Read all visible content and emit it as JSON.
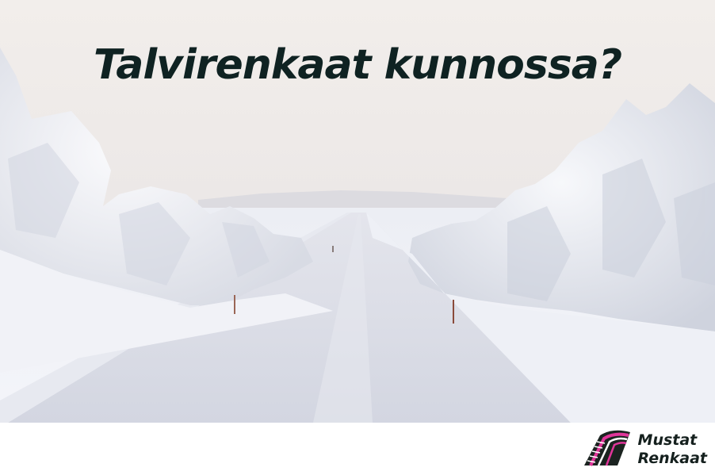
{
  "headline": "Talvirenkaat kunnossa?",
  "brand": {
    "line1": "Mustat",
    "line2": "Renkaat",
    "logo_icon": "tire-track-icon"
  },
  "colors": {
    "headline": "#0f2222",
    "brand_text": "#15201e",
    "logo_accent": "#e0359a",
    "logo_dark": "#1b2320"
  }
}
